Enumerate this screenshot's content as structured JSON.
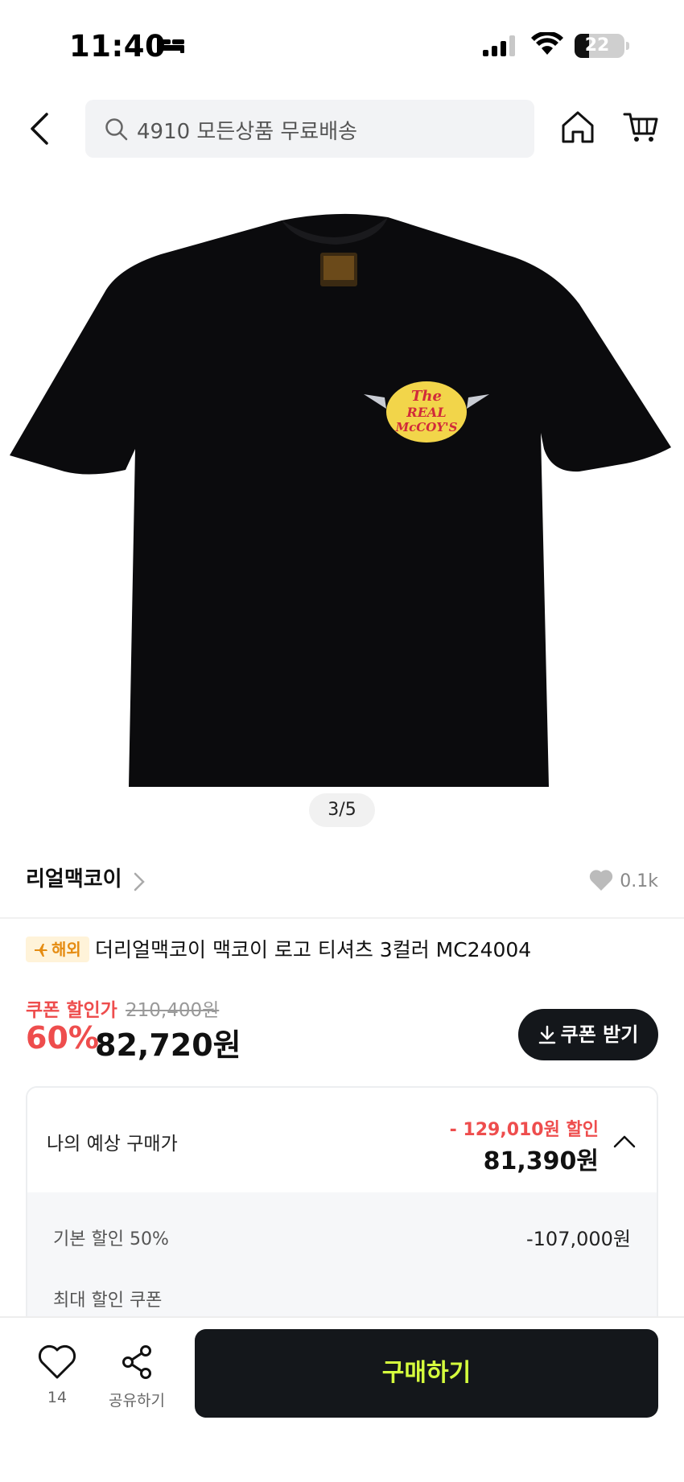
{
  "status_bar": {
    "time": "11:40",
    "battery": "22"
  },
  "header": {
    "search_placeholder": "4910 모든상품 무료배송"
  },
  "gallery": {
    "indicator": "3/5",
    "logo_text_top": "The",
    "logo_text_mid": "REAL",
    "logo_text_bottom": "McCOY'S"
  },
  "brand": {
    "name": "리얼맥코이",
    "likes": "0.1k"
  },
  "product": {
    "badge": "해외",
    "title": "더리얼맥코이 맥코이 로고 티셔츠 3컬러 MC24004"
  },
  "price": {
    "coupon_label": "쿠폰 할인가",
    "original": "210,400원",
    "discount": "60%",
    "final": "82,720원",
    "coupon_button": "쿠폰 받기"
  },
  "estimate": {
    "label": "나의 예상 구매가",
    "savings": "- 129,010원 할인",
    "price": "81,390원",
    "rows": [
      {
        "label": "기본 할인 50%",
        "value": "-107,000원"
      },
      {
        "label": "최대 할인 쿠폰",
        "value": ""
      }
    ]
  },
  "bottom_bar": {
    "like_count": "14",
    "share_label": "공유하기",
    "buy_label": "구매하기"
  },
  "colors": {
    "accent_red": "#ee4d4d",
    "buy_text": "#d6ff3d",
    "dark": "#14171b"
  }
}
